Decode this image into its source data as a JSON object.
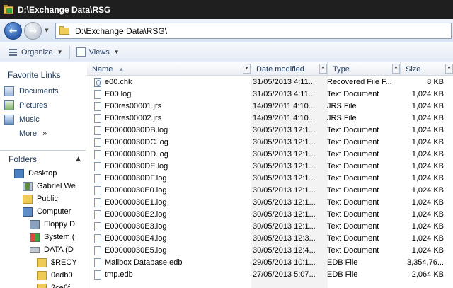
{
  "window": {
    "title": "D:\\Exchange Data\\RSG"
  },
  "address": {
    "path": "D:\\Exchange Data\\RSG\\"
  },
  "toolbar": {
    "organize_label": "Organize",
    "views_label": "Views"
  },
  "favorites": {
    "header": "Favorite Links",
    "items": [
      {
        "label": "Documents",
        "icon": "documents-icon"
      },
      {
        "label": "Pictures",
        "icon": "pictures-icon"
      },
      {
        "label": "Music",
        "icon": "music-icon"
      }
    ],
    "more_label": "More",
    "more_glyph": "»"
  },
  "folders": {
    "label": "Folders",
    "tree": [
      {
        "label": "Desktop",
        "icon": "desktop-icon"
      },
      {
        "label": "Gabriel We",
        "icon": "user-icon"
      },
      {
        "label": "Public",
        "icon": "folder-icon"
      },
      {
        "label": "Computer",
        "icon": "computer-icon"
      },
      {
        "label": "Floppy D",
        "icon": "floppy-icon"
      },
      {
        "label": "System (",
        "icon": "system-icon"
      },
      {
        "label": "DATA (D",
        "icon": "drive-icon"
      },
      {
        "label": "$RECY",
        "icon": "folder-icon"
      },
      {
        "label": "0edb0",
        "icon": "folder-icon"
      },
      {
        "label": "2ce6f",
        "icon": "folder-icon"
      }
    ]
  },
  "columns": {
    "name": "Name",
    "date": "Date modified",
    "type": "Type",
    "size": "Size"
  },
  "files": [
    {
      "name": "e00.chk",
      "date": "31/05/2013 4:11...",
      "type": "Recovered File F...",
      "size": "8 KB",
      "icon": "chk-file-icon"
    },
    {
      "name": "E00.log",
      "date": "31/05/2013 4:11...",
      "type": "Text Document",
      "size": "1,024 KB",
      "icon": "file-icon"
    },
    {
      "name": "E00res00001.jrs",
      "date": "14/09/2011 4:10...",
      "type": "JRS File",
      "size": "1,024 KB",
      "icon": "file-icon"
    },
    {
      "name": "E00res00002.jrs",
      "date": "14/09/2011 4:10...",
      "type": "JRS File",
      "size": "1,024 KB",
      "icon": "file-icon"
    },
    {
      "name": "E00000030DB.log",
      "date": "30/05/2013 12:1...",
      "type": "Text Document",
      "size": "1,024 KB",
      "icon": "file-icon"
    },
    {
      "name": "E00000030DC.log",
      "date": "30/05/2013 12:1...",
      "type": "Text Document",
      "size": "1,024 KB",
      "icon": "file-icon"
    },
    {
      "name": "E00000030DD.log",
      "date": "30/05/2013 12:1...",
      "type": "Text Document",
      "size": "1,024 KB",
      "icon": "file-icon"
    },
    {
      "name": "E00000030DE.log",
      "date": "30/05/2013 12:1...",
      "type": "Text Document",
      "size": "1,024 KB",
      "icon": "file-icon"
    },
    {
      "name": "E00000030DF.log",
      "date": "30/05/2013 12:1...",
      "type": "Text Document",
      "size": "1,024 KB",
      "icon": "file-icon"
    },
    {
      "name": "E00000030E0.log",
      "date": "30/05/2013 12:1...",
      "type": "Text Document",
      "size": "1,024 KB",
      "icon": "file-icon"
    },
    {
      "name": "E00000030E1.log",
      "date": "30/05/2013 12:1...",
      "type": "Text Document",
      "size": "1,024 KB",
      "icon": "file-icon"
    },
    {
      "name": "E00000030E2.log",
      "date": "30/05/2013 12:1...",
      "type": "Text Document",
      "size": "1,024 KB",
      "icon": "file-icon"
    },
    {
      "name": "E00000030E3.log",
      "date": "30/05/2013 12:1...",
      "type": "Text Document",
      "size": "1,024 KB",
      "icon": "file-icon"
    },
    {
      "name": "E00000030E4.log",
      "date": "30/05/2013 12:3...",
      "type": "Text Document",
      "size": "1,024 KB",
      "icon": "file-icon"
    },
    {
      "name": "E00000030E5.log",
      "date": "30/05/2013 12:4...",
      "type": "Text Document",
      "size": "1,024 KB",
      "icon": "file-icon"
    },
    {
      "name": "Mailbox Database.edb",
      "date": "29/05/2013 10:1...",
      "type": "EDB File",
      "size": "3,354,76...",
      "icon": "file-icon"
    },
    {
      "name": "tmp.edb",
      "date": "27/05/2013 5:07...",
      "type": "EDB File",
      "size": "2,064 KB",
      "icon": "file-icon"
    }
  ]
}
